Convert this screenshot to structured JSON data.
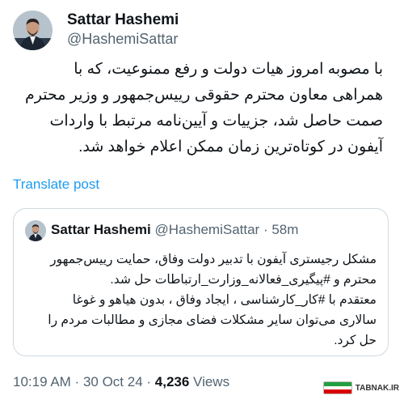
{
  "author": {
    "name": "Sattar Hashemi",
    "handle": "@HashemiSattar"
  },
  "tweet": {
    "lines": [
      "با مصوبه امروز هیات دولت و رفع ممنوعیت، که با",
      "همراهی معاون محترم حقوقی رییس‌جمهور و وزیر محترم",
      "صمت حاصل شد، جزییات و آیین‌نامه مرتبط با واردات",
      "آیفون در کوتاه‌ترین زمان ممکن اعلام خواهد شد."
    ],
    "translate_label": "Translate post"
  },
  "quoted": {
    "name": "Sattar Hashemi",
    "handle": "@HashemiSattar",
    "separator": " · ",
    "time": "58m",
    "lines": [
      "مشکل رجیستری آیفون با تدبیر دولت  وفاق، حمایت  رییس‌جمهور",
      "محترم و #پیگیری_فعالانه_وزارت_ارتباطات حل شد.",
      "معتقدم با #کار_کارشناسی ، ایجاد وفاق ، بدون هیاهو و غوغا",
      "سالاری می‌توان سایر مشکلات فضای مجازی و مطالبات مردم را",
      "حل کرد."
    ]
  },
  "meta": {
    "time": "10:19 AM",
    "separator": " · ",
    "date": "30 Oct 24",
    "views_count": "4,236",
    "views_label": "Views"
  },
  "watermark": {
    "text": "TABNAK.IR"
  },
  "colors": {
    "link": "#1d9bf0",
    "secondary": "#536471",
    "border": "#cfd9de"
  }
}
